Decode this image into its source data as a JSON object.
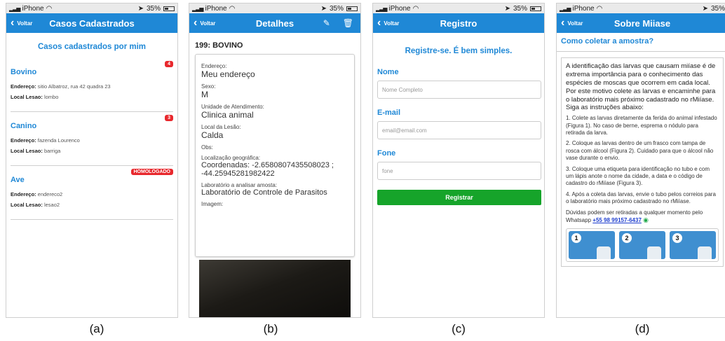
{
  "status": {
    "carrier": "iPhone",
    "battery": "35%"
  },
  "panel_a": {
    "back": "Voltar",
    "title": "Casos Cadastrados",
    "heading": "Casos cadastrados por mim",
    "field_endereco": "Endereço:",
    "field_local": "Local Lesao:",
    "cases": [
      {
        "name": "Bovino",
        "badge": "4",
        "endereco": "sitio Albatroz, rua 42 quadra 23",
        "local": "lombo"
      },
      {
        "name": "Canino",
        "badge": "3",
        "endereco": "fazenda Lourenco",
        "local": "barriga"
      },
      {
        "name": "Ave",
        "badge": "HOMOLOGADO",
        "endereco": "endereco2",
        "local": "lesao2"
      }
    ],
    "caption": "(a)"
  },
  "panel_b": {
    "back": "Voltar",
    "title": "Detalhes",
    "case_title": "199: BOVINO",
    "fields": [
      {
        "label": "Endereço:",
        "value": "Meu endereço"
      },
      {
        "label": "Sexo:",
        "value": "M"
      },
      {
        "label": "Unidade de Atendimento:",
        "value": "Clinica animal"
      },
      {
        "label": "Local da Lesão:",
        "value": "Calda"
      },
      {
        "label": "Obs:",
        "value": ""
      },
      {
        "label": "Localização geográfica:",
        "value": "Coordenadas: -2.6580807435508023 ; -44.25945281982422"
      },
      {
        "label": "Laboratório a analisar amosta:",
        "value": "Laboratório de Controle de Parasitos"
      }
    ],
    "image_label": "Imagem:",
    "caption": "(b)"
  },
  "panel_c": {
    "back": "Voltar",
    "title": "Registro",
    "heading": "Registre-se. É bem simples.",
    "name_label": "Nome",
    "name_placeholder": "Nome Completo",
    "email_label": "E-mail",
    "email_placeholder": "email@email.com",
    "phone_label": "Fone",
    "phone_placeholder": "fone",
    "submit": "Registrar",
    "caption": "(c)"
  },
  "panel_d": {
    "back": "Voltar",
    "title": "Sobre Miiase",
    "heading": "Como coletar a amostra?",
    "intro": "A identificação das larvas que causam miíase é de extrema importância para o conhecimento das espécies de moscas que ocorrem em cada local. Por este motivo colete as larvas e encaminhe para o laboratório mais próximo cadastrado no rMiíase. Siga as instruções abaixo:",
    "steps": [
      "1. Colete as larvas diretamente da ferida do animal infestado (Figura 1). No caso de berne, esprema o nódulo para retirada da larva.",
      "2. Coloque as larvas dentro de um frasco com tampa de rosca com álcool (Figura 2). Cuidado para que o álcool não vase durante o envio.",
      "3. Coloque uma etiqueta para identificação no tubo e com um lápis anote o nome da cidade, a data e o código de cadastro do rMiíase (Figura 3).",
      "4. Após a coleta das larvas, envie o tubo pelos correios para o laboratório mais próximo cadastrado no rMiíase."
    ],
    "contact_text": "Dúvidas podem ser retiradas a qualquer momento pelo Whatsapp",
    "contact_phone": "+55 98 99157-6437",
    "fig_numbers": [
      "1",
      "2",
      "3"
    ],
    "caption": "(d)"
  }
}
